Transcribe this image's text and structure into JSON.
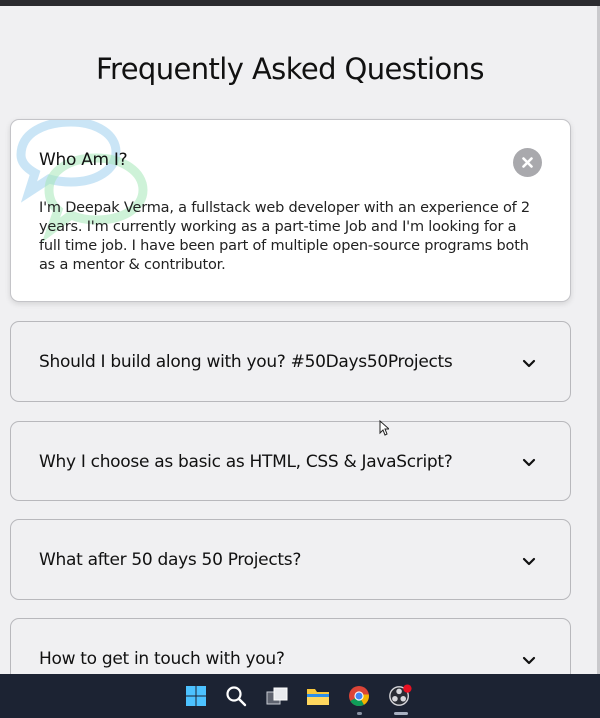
{
  "page_title": "Frequently Asked Questions",
  "faqs": [
    {
      "question": "Who Am I?",
      "answer": "I'm Deepak Verma, a fullstack web developer with an experience of 2 years. I'm currently working as a part-time Job and I'm looking for a full time job. I have been part of multiple open-source programs both as a mentor & contributor.",
      "open": true
    },
    {
      "question": "Should I build along with you? #50Days50Projects",
      "open": false
    },
    {
      "question": "Why I choose as basic as HTML, CSS & JavaScript?",
      "open": false
    },
    {
      "question": "What after 50 days 50 Projects?",
      "open": false
    },
    {
      "question": "How to get in touch with you?",
      "open": false
    }
  ],
  "taskbar": {
    "icons": [
      "windows-start-icon",
      "search-icon",
      "task-view-icon",
      "file-explorer-icon",
      "chrome-icon",
      "obs-icon"
    ]
  },
  "colors": {
    "background": "#f0f0f2",
    "card_open": "#ffffff",
    "border": "#b8b8bc",
    "close_button": "#a9a9ad",
    "taskbar": "#1c2333"
  }
}
